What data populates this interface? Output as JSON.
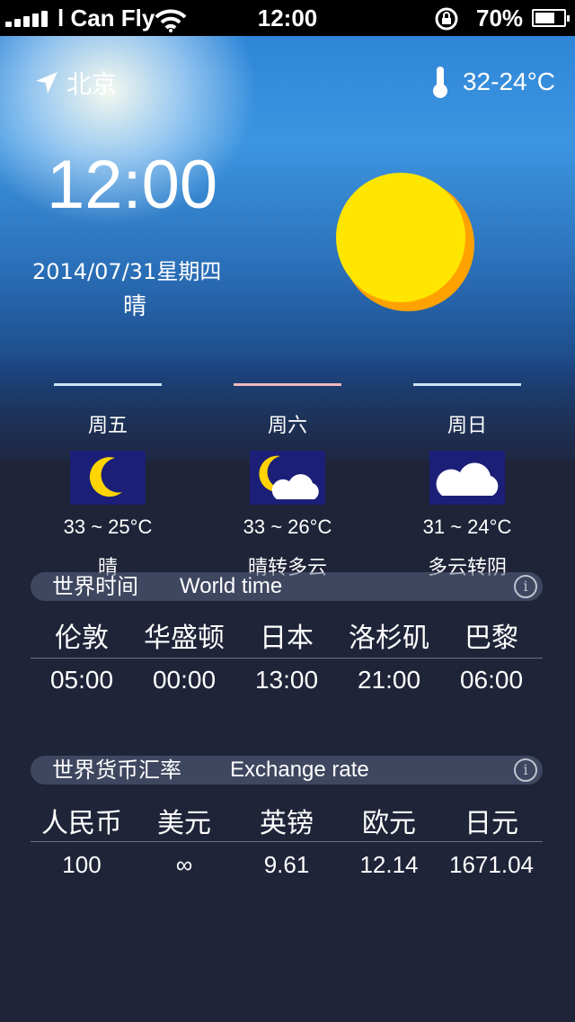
{
  "status_bar": {
    "carrier": "l Can Fly",
    "time": "12:00",
    "battery": "70%",
    "battery_level": 0.7
  },
  "location": {
    "city": "北京",
    "temp_range": "32-24°C"
  },
  "current": {
    "time": "12:00",
    "date": "2014/07/31星期四",
    "condition": "晴",
    "icon": "sun-icon"
  },
  "forecast": [
    {
      "day": "周五",
      "temp": "33 ~ 25°C",
      "desc": "晴",
      "icon": "moon-icon",
      "line_color": "#cfe3f0"
    },
    {
      "day": "周六",
      "temp": "33 ~ 26°C",
      "desc": "晴转多云",
      "icon": "moon-cloud-icon",
      "line_color": "#f3b8bc"
    },
    {
      "day": "周日",
      "temp": "31 ~ 24°C",
      "desc": "多云转阴",
      "icon": "cloud-icon",
      "line_color": "#cfe3f0"
    }
  ],
  "world_time": {
    "title_zh": "世界时间",
    "title_en": "World time",
    "cities": [
      "伦敦",
      "华盛顿",
      "日本",
      "洛杉矶",
      "巴黎"
    ],
    "times": [
      "05:00",
      "00:00",
      "13:00",
      "21:00",
      "06:00"
    ]
  },
  "exchange": {
    "title_zh": "世界货币汇率",
    "title_en": "Exchange rate",
    "currencies": [
      "人民币",
      "美元",
      "英镑",
      "欧元",
      "日元"
    ],
    "values": [
      "100",
      "∞",
      "9.61",
      "12.14",
      "1671.04"
    ]
  },
  "colors": {
    "background": "#1f2438",
    "sun_yellow": "#ffe600",
    "sun_orange": "#ffa200",
    "icon_bg": "#1c1f78"
  }
}
